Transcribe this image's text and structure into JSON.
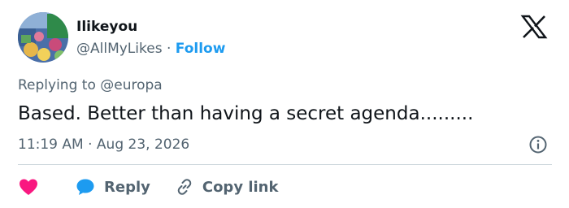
{
  "user": {
    "display_name": "Ilikeyou",
    "handle": "@AllMyLikes",
    "separator": " · ",
    "follow_label": "Follow",
    "avatar_icon": "avatar-image"
  },
  "reply": {
    "prefix": "Replying to ",
    "target": "@europa"
  },
  "tweet": {
    "text": "Based. Better than having a secret agenda........."
  },
  "meta": {
    "time": "11:19 AM",
    "separator": " · ",
    "date": "Aug 23, 2026",
    "info_icon": "info-icon"
  },
  "actions": {
    "like_icon": "heart-icon",
    "reply_icon": "speech-bubble-icon",
    "reply_label": "Reply",
    "copy_icon": "link-icon",
    "copy_label": "Copy link"
  },
  "brand": {
    "logo": "x-logo",
    "colors": {
      "accent": "#1d9bf0",
      "heart": "#f91880",
      "secondary_text": "#536471",
      "primary_text": "#0f1419"
    }
  }
}
